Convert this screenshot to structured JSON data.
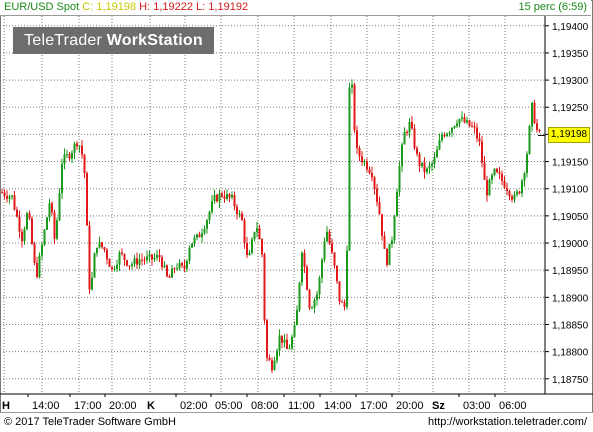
{
  "header": {
    "symbol": "EUR/USD Spot",
    "close_label": "C:",
    "close_value": "1,19198",
    "high_label": "H:",
    "high_value": "1,19222",
    "low_label": "L:",
    "low_value": "1,19192",
    "interval": "15 perc (6:59)"
  },
  "logo": {
    "part1": "TeleTrader",
    "part2": "WorkStation"
  },
  "footer": {
    "copyright": "© 2017  TeleTrader Software GmbH",
    "website": "http://workstation.teletrader.com/"
  },
  "chart_data": {
    "type": "candlestick",
    "current_price": "1,19198",
    "y_ticks": [
      "1,19400",
      "1,19350",
      "1,19300",
      "1,19250",
      "1,19200",
      "1,19150",
      "1,19100",
      "1,19050",
      "1,19000",
      "1,18950",
      "1,18900",
      "1,18850",
      "1,18800",
      "1,18750"
    ],
    "ylim": [
      1.1872,
      1.1942
    ],
    "x_ticks": [
      "14:00",
      "17:00",
      "20:00",
      "02:00",
      "05:00",
      "08:00",
      "11:00",
      "14:00",
      "17:00",
      "20:00",
      "03:00",
      "06:00"
    ],
    "day_markers": [
      "H",
      "K",
      "Sz"
    ],
    "grid": true,
    "up_color": "#1a9a1a",
    "down_color": "#e01818",
    "series": [
      {
        "x": 0,
        "y": 1.19095
      },
      {
        "x": 12,
        "y": 1.19085
      },
      {
        "x": 22,
        "y": 1.1901
      },
      {
        "x": 28,
        "y": 1.1906
      },
      {
        "x": 36,
        "y": 1.18935
      },
      {
        "x": 42,
        "y": 1.18995
      },
      {
        "x": 50,
        "y": 1.1908
      },
      {
        "x": 55,
        "y": 1.19
      },
      {
        "x": 62,
        "y": 1.1915
      },
      {
        "x": 70,
        "y": 1.19165
      },
      {
        "x": 78,
        "y": 1.1919
      },
      {
        "x": 84,
        "y": 1.1915
      },
      {
        "x": 90,
        "y": 1.189
      },
      {
        "x": 96,
        "y": 1.19
      },
      {
        "x": 104,
        "y": 1.1899
      },
      {
        "x": 112,
        "y": 1.1895
      },
      {
        "x": 120,
        "y": 1.1898
      },
      {
        "x": 130,
        "y": 1.1896
      },
      {
        "x": 140,
        "y": 1.1897
      },
      {
        "x": 150,
        "y": 1.1897
      },
      {
        "x": 160,
        "y": 1.18975
      },
      {
        "x": 168,
        "y": 1.1893
      },
      {
        "x": 176,
        "y": 1.1896
      },
      {
        "x": 184,
        "y": 1.1895
      },
      {
        "x": 190,
        "y": 1.19
      },
      {
        "x": 198,
        "y": 1.1901
      },
      {
        "x": 206,
        "y": 1.1904
      },
      {
        "x": 214,
        "y": 1.1908
      },
      {
        "x": 222,
        "y": 1.1909
      },
      {
        "x": 232,
        "y": 1.1908
      },
      {
        "x": 242,
        "y": 1.1904
      },
      {
        "x": 248,
        "y": 1.1896
      },
      {
        "x": 256,
        "y": 1.1904
      },
      {
        "x": 262,
        "y": 1.1898
      },
      {
        "x": 266,
        "y": 1.1879
      },
      {
        "x": 272,
        "y": 1.18775
      },
      {
        "x": 280,
        "y": 1.1883
      },
      {
        "x": 288,
        "y": 1.188
      },
      {
        "x": 296,
        "y": 1.1885
      },
      {
        "x": 302,
        "y": 1.1899
      },
      {
        "x": 310,
        "y": 1.1888
      },
      {
        "x": 318,
        "y": 1.1891
      },
      {
        "x": 326,
        "y": 1.1903
      },
      {
        "x": 334,
        "y": 1.1896
      },
      {
        "x": 340,
        "y": 1.1889
      },
      {
        "x": 346,
        "y": 1.1888
      },
      {
        "x": 350,
        "y": 1.1934
      },
      {
        "x": 356,
        "y": 1.1917
      },
      {
        "x": 364,
        "y": 1.1915
      },
      {
        "x": 372,
        "y": 1.1913
      },
      {
        "x": 380,
        "y": 1.1905
      },
      {
        "x": 386,
        "y": 1.1896
      },
      {
        "x": 392,
        "y": 1.1901
      },
      {
        "x": 398,
        "y": 1.1912
      },
      {
        "x": 404,
        "y": 1.192
      },
      {
        "x": 410,
        "y": 1.1922
      },
      {
        "x": 418,
        "y": 1.1915
      },
      {
        "x": 426,
        "y": 1.1913
      },
      {
        "x": 434,
        "y": 1.1915
      },
      {
        "x": 442,
        "y": 1.192
      },
      {
        "x": 450,
        "y": 1.1921
      },
      {
        "x": 458,
        "y": 1.1923
      },
      {
        "x": 466,
        "y": 1.1922
      },
      {
        "x": 474,
        "y": 1.1921
      },
      {
        "x": 480,
        "y": 1.1918
      },
      {
        "x": 486,
        "y": 1.1909
      },
      {
        "x": 494,
        "y": 1.1913
      },
      {
        "x": 500,
        "y": 1.1912
      },
      {
        "x": 508,
        "y": 1.191
      },
      {
        "x": 514,
        "y": 1.1908
      },
      {
        "x": 520,
        "y": 1.191
      },
      {
        "x": 526,
        "y": 1.1915
      },
      {
        "x": 532,
        "y": 1.1925
      },
      {
        "x": 538,
        "y": 1.19198
      }
    ]
  }
}
